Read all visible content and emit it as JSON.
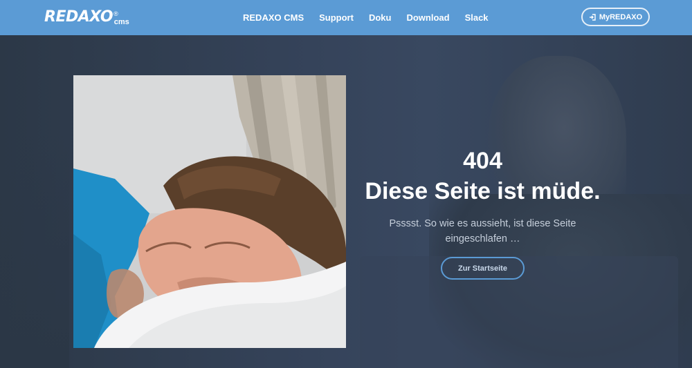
{
  "header": {
    "logo": {
      "text": "REDAXO",
      "suffix": "cms",
      "registered": "®"
    },
    "nav": [
      {
        "label": "REDAXO CMS"
      },
      {
        "label": "Support"
      },
      {
        "label": "Doku"
      },
      {
        "label": "Download"
      },
      {
        "label": "Slack"
      }
    ],
    "account_button": {
      "label": "MyREDAXO",
      "icon": "sign-in-icon"
    }
  },
  "hero": {
    "code": "404",
    "title": "Diese Seite ist müde.",
    "text": "Psssst. So wie es aussieht, ist diese Seite eingeschlafen …",
    "button_label": "Zur Startseite",
    "photo_alt": "sleeping-man-photo"
  },
  "colors": {
    "header_bg": "#5b9bd5",
    "hero_bg": "#2d3a4a",
    "accent": "#5b9bd5",
    "text_light": "#ffffff",
    "text_muted": "#c6cfdb"
  }
}
